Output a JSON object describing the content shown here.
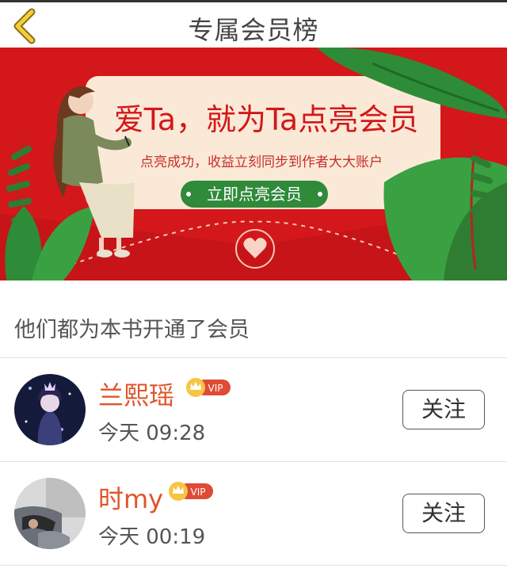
{
  "header": {
    "title": "专属会员榜",
    "back_icon": "chevron-left-icon"
  },
  "banner": {
    "headline": "爱Ta，就为Ta点亮会员",
    "subline": "点亮成功，收益立刻同步到作者大大账户",
    "cta": "立即点亮会员",
    "colors": {
      "background": "#d3171a",
      "card": "#fbe9d7",
      "headline": "#d3171a",
      "cta": "#2f8a3a"
    }
  },
  "list": {
    "title": "他们都为本书开通了会员",
    "members": [
      {
        "name": "兰熙瑶",
        "badge": "VIP",
        "time": "今天 09:28",
        "follow_label": "关注"
      },
      {
        "name": "时my",
        "badge": "VIP",
        "time": "今天 00:19",
        "follow_label": "关注"
      }
    ]
  },
  "colors": {
    "name": "#e0542a",
    "vip_badge": "#e04a36",
    "crown": "#f2b21b"
  }
}
